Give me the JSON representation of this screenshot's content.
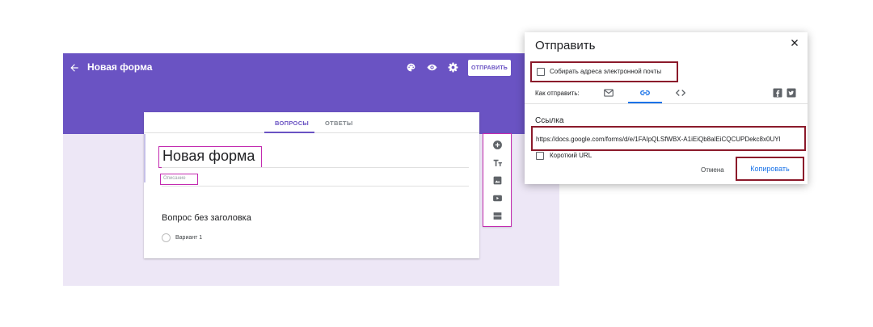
{
  "editor": {
    "form_name": "Новая форма",
    "send_label": "ОТПРАВИТЬ",
    "accent": "#6a53c3",
    "tabs": [
      {
        "label": "ВОПРОСЫ",
        "active": true
      },
      {
        "label": "ОТВЕТЫ",
        "active": false
      }
    ],
    "form_title": "Новая форма",
    "description_placeholder": "Описание",
    "question_title": "Вопрос без заголовка",
    "option_label": "Вариант 1",
    "toolbar_icons": [
      "palette-icon",
      "eye-icon",
      "gear-icon"
    ],
    "tools": [
      "add-question-icon",
      "add-title-icon",
      "add-image-icon",
      "add-video-icon",
      "add-section-icon"
    ]
  },
  "dialog": {
    "title": "Отправить",
    "collect_emails_label": "Собирать адреса электронной почты",
    "collect_emails_checked": false,
    "how_to_send_label": "Как отправить:",
    "send_methods": [
      "email-icon",
      "link-icon",
      "embed-icon"
    ],
    "active_method": "link-icon",
    "share_icons": [
      "facebook-icon",
      "twitter-icon"
    ],
    "link_label": "Ссылка",
    "link_url": "https://docs.google.com/forms/d/e/1FAIpQLSfWBX-A1iEiQb8alEiCQCUPDekc8x0UYl",
    "short_url_label": "Короткий URL",
    "short_url_checked": false,
    "cancel_label": "Отмена",
    "copy_label": "Копировать",
    "highlight_color": "#8b1a2b",
    "link_color": "#1a73e8"
  }
}
